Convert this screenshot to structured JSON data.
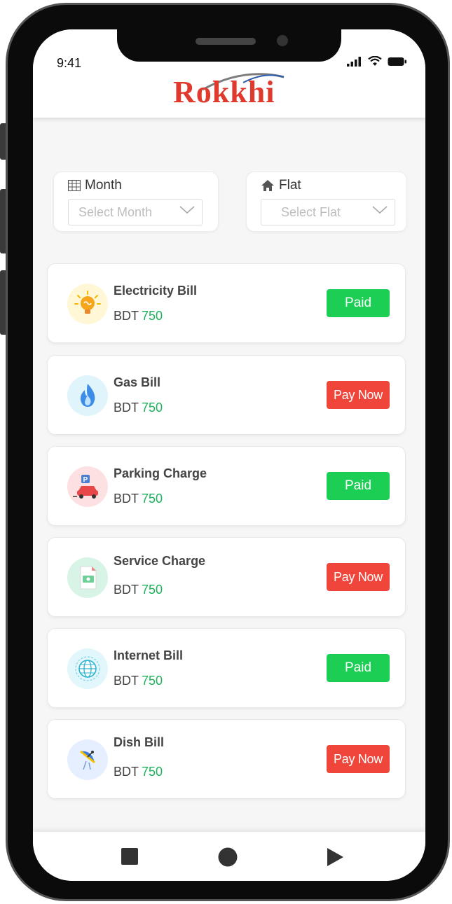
{
  "status_bar": {
    "time": "9:41",
    "icons": [
      "signal-icon",
      "wifi-icon",
      "battery-icon"
    ]
  },
  "header": {
    "logo_text": "Rokkhi"
  },
  "filters": {
    "month": {
      "label": "Month",
      "placeholder": "Select Month",
      "icon": "calendar-grid-icon"
    },
    "flat": {
      "label": "Flat",
      "placeholder": "Select Flat",
      "icon": "home-icon"
    }
  },
  "bills": [
    {
      "name": "Electricity Bill",
      "currency": "BDT",
      "amount": "750",
      "status": "Paid",
      "icon": "lightbulb-icon"
    },
    {
      "name": "Gas Bill",
      "currency": "BDT",
      "amount": "750",
      "status": "Pay Now",
      "icon": "flame-icon"
    },
    {
      "name": "Parking Charge",
      "currency": "BDT",
      "amount": "750",
      "status": "Paid",
      "icon": "car-parking-icon"
    },
    {
      "name": "Service Charge",
      "currency": "BDT",
      "amount": "750",
      "status": "Pay Now",
      "icon": "cash-document-icon"
    },
    {
      "name": "Internet Bill",
      "currency": "BDT",
      "amount": "750",
      "status": "Paid",
      "icon": "globe-icon"
    },
    {
      "name": "Dish Bill",
      "currency": "BDT",
      "amount": "750",
      "status": "Pay Now",
      "icon": "satellite-dish-icon"
    }
  ],
  "nav_bar": [
    "stop-square-icon",
    "home-circle-icon",
    "back-triangle-icon"
  ],
  "colors": {
    "paid": "#1dce55",
    "pay_now": "#f0453a",
    "amount": "#1cb35c",
    "logo": "#e03a2f"
  }
}
